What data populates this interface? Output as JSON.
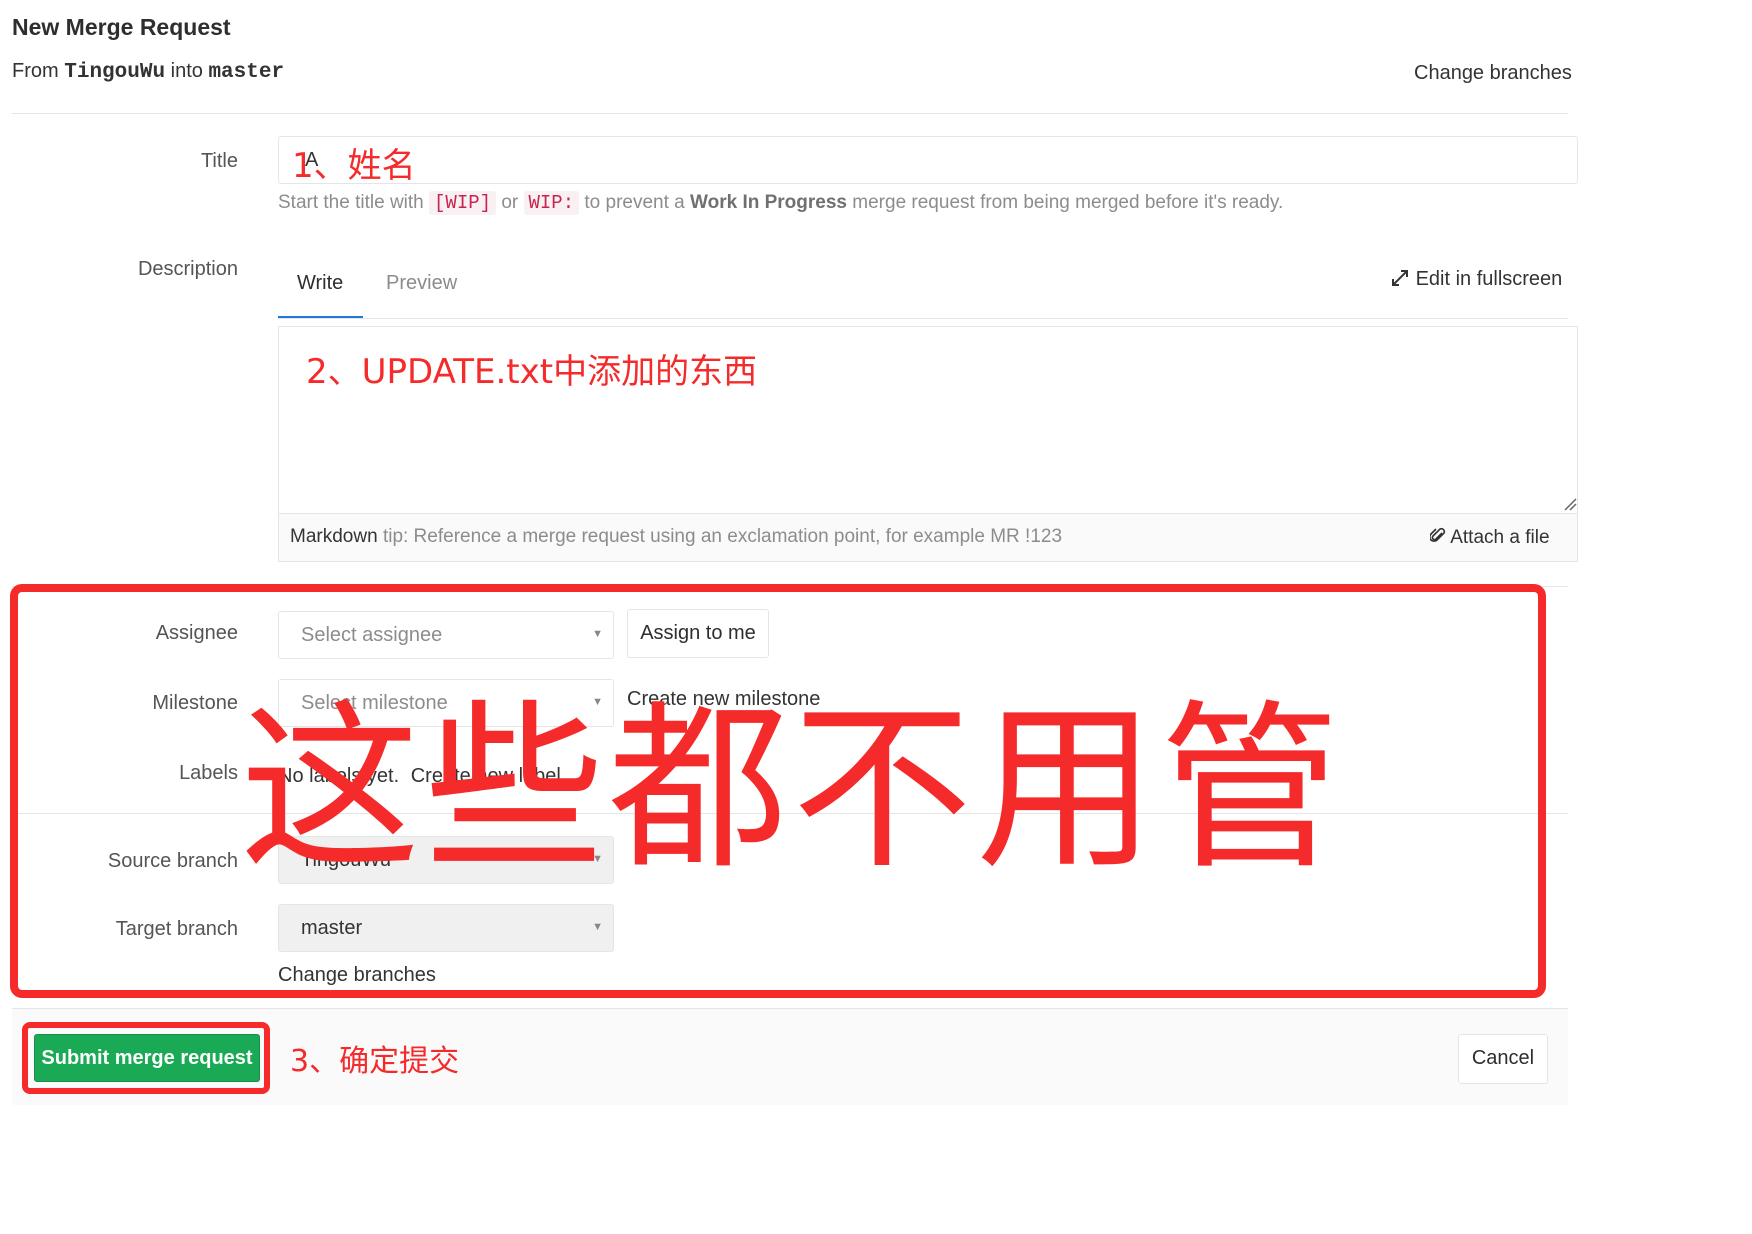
{
  "header": {
    "title": "New Merge Request",
    "from_word": "From",
    "source_branch": "TingouWu",
    "into_word": "into",
    "target_branch": "master",
    "change_branches": "Change branches"
  },
  "form": {
    "title_label": "Title",
    "title_value": "A",
    "wip_hint_prefix": "Start the title with",
    "wip_code1": "[WIP]",
    "wip_or": "or",
    "wip_code2": "WIP:",
    "wip_hint_mid": "to prevent a",
    "wip_bold": "Work In Progress",
    "wip_hint_suffix": "merge request from being merged before it's ready.",
    "description_label": "Description",
    "tabs": [
      {
        "label": "Write",
        "active": true
      },
      {
        "label": "Preview",
        "active": false
      }
    ],
    "edit_fullscreen": "Edit in fullscreen",
    "markdown_word": "Markdown",
    "markdown_tip": "tip: Reference a merge request using an exclamation point, for example MR !123",
    "attach_file": "Attach a file",
    "assignee_label": "Assignee",
    "assignee_placeholder": "Select assignee",
    "assign_to_me": "Assign to me",
    "milestone_label": "Milestone",
    "milestone_placeholder": "Select milestone",
    "create_milestone": "Create new milestone",
    "labels_label": "Labels",
    "labels_text": "No labels yet.",
    "create_label": "Create new label",
    "source_branch_label": "Source branch",
    "source_branch_value": "TingouWu",
    "target_branch_label": "Target branch",
    "target_branch_value": "master",
    "change_branches": "Change branches"
  },
  "footer": {
    "submit": "Submit merge request",
    "cancel": "Cancel"
  },
  "annotations": {
    "note1": "1、姓名",
    "note2": "2、UPDATE.txt中添加的东西",
    "big_note": "这些都不用管",
    "note3": "3、确定提交",
    "color": "#f52a2a"
  },
  "colors": {
    "submit_green": "#1aaa55",
    "tab_active_blue": "#1f78d1"
  }
}
